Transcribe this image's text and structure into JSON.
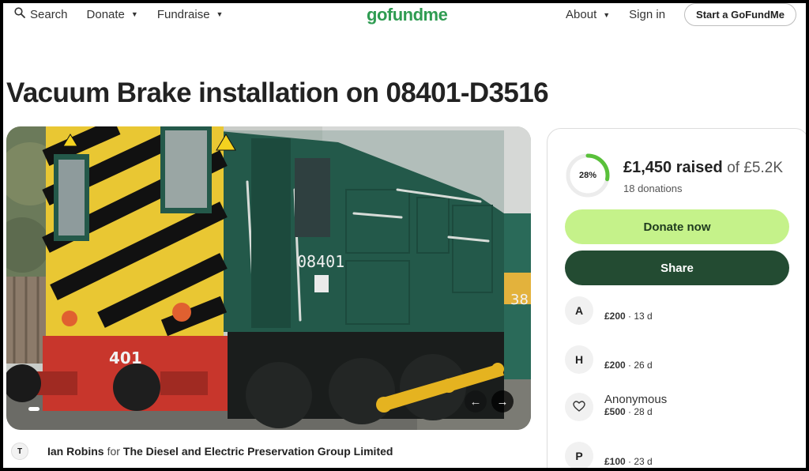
{
  "header": {
    "search_label": "Search",
    "donate_label": "Donate",
    "fundraise_label": "Fundraise",
    "logo_text": "gofundme",
    "about_label": "About",
    "sign_in_label": "Sign in",
    "start_label": "Start a GoFundMe"
  },
  "page": {
    "title": "Vacuum Brake installation on 08401-D3516"
  },
  "photo": {
    "loco_number": "08401",
    "buffer_number": "401",
    "side_number_partial": "38"
  },
  "organizer": {
    "avatar_initial": "T",
    "name": "Ian Robins",
    "for_text": "for",
    "group": "The Diesel and Electric Preservation Group Limited"
  },
  "sidebar": {
    "progress_percent": 28,
    "progress_label": "28%",
    "raised": "£1,450 raised",
    "goal": "of £5.2K",
    "donations": "18 donations",
    "donate_button": "Donate now",
    "share_button": "Share",
    "donors": [
      {
        "initial": "A",
        "name": "",
        "amount": "£200",
        "time": " · 13 d"
      },
      {
        "initial": "H",
        "name": "",
        "amount": "£200",
        "time": " · 26 d"
      },
      {
        "initial": "",
        "name": "Anonymous",
        "amount": "£500",
        "time": " · 28 d"
      },
      {
        "initial": "P",
        "name": "",
        "amount": "£100",
        "time": " · 23 d"
      }
    ]
  },
  "colors": {
    "brand_green": "#2f9c52",
    "donate_button": "#c5f28a",
    "share_button": "#234b32",
    "progress_ring": "#59c03a"
  },
  "icons": {
    "search": "search-icon",
    "dropdown": "chevron-down-icon",
    "donor_anonymous": "heart-hand-icon",
    "carousel_prev": "arrow-left-icon",
    "carousel_next": "arrow-right-icon"
  }
}
